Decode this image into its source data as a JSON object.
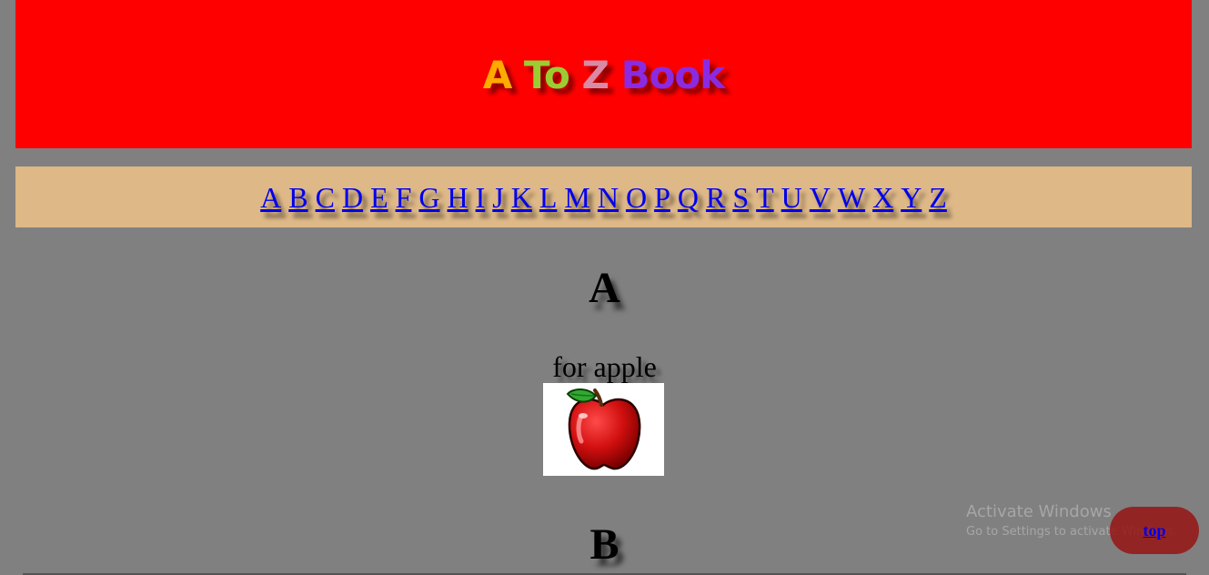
{
  "header": {
    "title_words": [
      "A",
      "To",
      "Z",
      "Book"
    ],
    "colors": [
      "#ffaa00",
      "#9acd32",
      "#d98aa6",
      "#8a2be2"
    ]
  },
  "nav": {
    "letters": [
      "A",
      "B",
      "C",
      "D",
      "E",
      "F",
      "G",
      "H",
      "I",
      "J",
      "K",
      "L",
      "M",
      "N",
      "O",
      "P",
      "Q",
      "R",
      "S",
      "T",
      "U",
      "V",
      "W",
      "X",
      "Y",
      "Z"
    ]
  },
  "sections": [
    {
      "letter": "A",
      "caption": "for apple",
      "image": "apple-image"
    },
    {
      "letter": "B"
    }
  ],
  "top_button": {
    "label": "top"
  },
  "watermark": {
    "title": "Activate Windows",
    "subtitle": "Go to Settings to activate Windows."
  },
  "colors": {
    "header_bg": "#ff0000",
    "nav_bg": "#deb887",
    "page_bg": "#808080",
    "link": "#0000ee"
  }
}
